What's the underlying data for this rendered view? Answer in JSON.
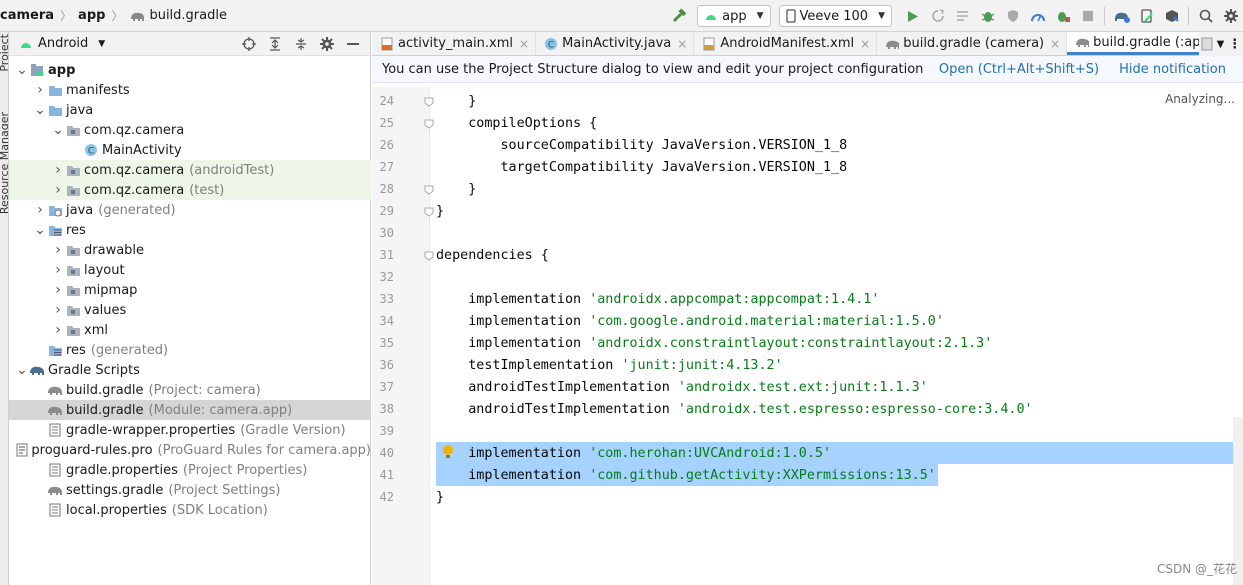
{
  "breadcrumb": {
    "project": "camera",
    "module": "app",
    "file": "build.gradle"
  },
  "toolbar": {
    "run_config": "app",
    "device": "Veeve 100"
  },
  "side_strip": {
    "project": "Project",
    "resource_manager": "Resource Manager"
  },
  "project_panel": {
    "view": "Android",
    "tree": [
      {
        "label": "app",
        "secondary": "",
        "level": 0,
        "arrow": "down",
        "icon": "module-icon",
        "bold": true
      },
      {
        "label": "manifests",
        "secondary": "",
        "level": 1,
        "arrow": "right",
        "icon": "folder-icon"
      },
      {
        "label": "java",
        "secondary": "",
        "level": 1,
        "arrow": "down",
        "icon": "folder-icon"
      },
      {
        "label": "com.qz.camera",
        "secondary": "",
        "level": 2,
        "arrow": "down",
        "icon": "package-icon"
      },
      {
        "label": "MainActivity",
        "secondary": "",
        "level": 3,
        "arrow": "",
        "icon": "class-icon"
      },
      {
        "label": "com.qz.camera",
        "secondary": "(androidTest)",
        "level": 2,
        "arrow": "right",
        "icon": "package-icon",
        "green": true
      },
      {
        "label": "com.qz.camera",
        "secondary": "(test)",
        "level": 2,
        "arrow": "right",
        "icon": "package-icon",
        "green": true
      },
      {
        "label": "java",
        "secondary": "(generated)",
        "level": 1,
        "arrow": "right",
        "icon": "generated-folder-icon"
      },
      {
        "label": "res",
        "secondary": "",
        "level": 1,
        "arrow": "down",
        "icon": "res-folder-icon"
      },
      {
        "label": "drawable",
        "secondary": "",
        "level": 2,
        "arrow": "right",
        "icon": "package-icon"
      },
      {
        "label": "layout",
        "secondary": "",
        "level": 2,
        "arrow": "right",
        "icon": "package-icon"
      },
      {
        "label": "mipmap",
        "secondary": "",
        "level": 2,
        "arrow": "right",
        "icon": "package-icon"
      },
      {
        "label": "values",
        "secondary": "",
        "level": 2,
        "arrow": "right",
        "icon": "package-icon"
      },
      {
        "label": "xml",
        "secondary": "",
        "level": 2,
        "arrow": "right",
        "icon": "package-icon"
      },
      {
        "label": "res",
        "secondary": "(generated)",
        "level": 1,
        "arrow": "",
        "icon": "res-folder-icon"
      },
      {
        "label": "Gradle Scripts",
        "secondary": "",
        "level": 0,
        "arrow": "down",
        "icon": "gradle-icon"
      },
      {
        "label": "build.gradle",
        "secondary": "(Project: camera)",
        "level": 1,
        "arrow": "",
        "icon": "gradle-file-icon"
      },
      {
        "label": "build.gradle",
        "secondary": "(Module: camera.app)",
        "level": 1,
        "arrow": "",
        "icon": "gradle-file-icon",
        "selected": true
      },
      {
        "label": "gradle-wrapper.properties",
        "secondary": "(Gradle Version)",
        "level": 1,
        "arrow": "",
        "icon": "properties-file-icon"
      },
      {
        "label": "proguard-rules.pro",
        "secondary": "(ProGuard Rules for camera.app)",
        "level": 1,
        "arrow": "",
        "icon": "proguard-file-icon"
      },
      {
        "label": "gradle.properties",
        "secondary": "(Project Properties)",
        "level": 1,
        "arrow": "",
        "icon": "properties-file-icon"
      },
      {
        "label": "settings.gradle",
        "secondary": "(Project Settings)",
        "level": 1,
        "arrow": "",
        "icon": "gradle-file-icon"
      },
      {
        "label": "local.properties",
        "secondary": "(SDK Location)",
        "level": 1,
        "arrow": "",
        "icon": "properties-file-icon"
      }
    ]
  },
  "tabs": [
    {
      "label": "activity_main.xml",
      "icon": "xml-file-icon",
      "active": false
    },
    {
      "label": "MainActivity.java",
      "icon": "class-icon",
      "active": false
    },
    {
      "label": "AndroidManifest.xml",
      "icon": "manifest-file-icon",
      "active": false
    },
    {
      "label": "build.gradle (camera)",
      "icon": "gradle-file-icon",
      "active": false
    },
    {
      "label": "build.gradle (:app)",
      "icon": "gradle-file-icon",
      "active": true
    }
  ],
  "notification": {
    "message": "You can use the Project Structure dialog to view and edit your project configuration",
    "open_link": "Open (Ctrl+Alt+Shift+S)",
    "hide_link": "Hide notification"
  },
  "editor": {
    "status": "Analyzing...",
    "lines": [
      {
        "num": "24",
        "parts": [
          [
            "    }",
            "plain"
          ]
        ]
      },
      {
        "num": "25",
        "parts": [
          [
            "    compileOptions {",
            "plain"
          ]
        ]
      },
      {
        "num": "26",
        "parts": [
          [
            "        sourceCompatibility JavaVersion.VERSION_1_8",
            "plain"
          ]
        ]
      },
      {
        "num": "27",
        "parts": [
          [
            "        targetCompatibility JavaVersion.VERSION_1_8",
            "plain"
          ]
        ]
      },
      {
        "num": "28",
        "parts": [
          [
            "    }",
            "plain"
          ]
        ]
      },
      {
        "num": "29",
        "parts": [
          [
            "}",
            "plain"
          ]
        ]
      },
      {
        "num": "30",
        "parts": []
      },
      {
        "num": "31",
        "parts": [
          [
            "dependencies {",
            "plain"
          ]
        ]
      },
      {
        "num": "32",
        "parts": []
      },
      {
        "num": "33",
        "parts": [
          [
            "    implementation ",
            "plain"
          ],
          [
            "'androidx.appcompat:appcompat:1.4.1'",
            "str"
          ]
        ]
      },
      {
        "num": "34",
        "parts": [
          [
            "    implementation ",
            "plain"
          ],
          [
            "'com.google.android.material:material:1.5.0'",
            "str"
          ]
        ]
      },
      {
        "num": "35",
        "parts": [
          [
            "    implementation ",
            "plain"
          ],
          [
            "'androidx.constraintlayout:constraintlayout:2.1.3'",
            "str"
          ]
        ]
      },
      {
        "num": "36",
        "parts": [
          [
            "    testImplementation ",
            "plain"
          ],
          [
            "'junit:junit:4.13.2'",
            "str"
          ]
        ]
      },
      {
        "num": "37",
        "parts": [
          [
            "    androidTestImplementation ",
            "plain"
          ],
          [
            "'androidx.test.ext:junit:1.1.3'",
            "str"
          ]
        ]
      },
      {
        "num": "38",
        "parts": [
          [
            "    androidTestImplementation ",
            "plain"
          ],
          [
            "'androidx.test.espresso:espresso-core:3.4.0'",
            "str"
          ]
        ]
      },
      {
        "num": "39",
        "parts": []
      },
      {
        "num": "40",
        "parts": [
          [
            "    implementation ",
            "plain"
          ],
          [
            "'com.herohan:UVCAndroid:1.0.5'",
            "str"
          ]
        ],
        "selected": "full"
      },
      {
        "num": "41",
        "parts": [
          [
            "    implementation ",
            "plain"
          ],
          [
            "'com.github.getActivity:XXPermissions:13.5'",
            "str"
          ]
        ],
        "selected": "partial"
      },
      {
        "num": "42",
        "parts": [
          [
            "}",
            "plain"
          ]
        ]
      }
    ]
  },
  "watermark": "CSDN @_花花"
}
